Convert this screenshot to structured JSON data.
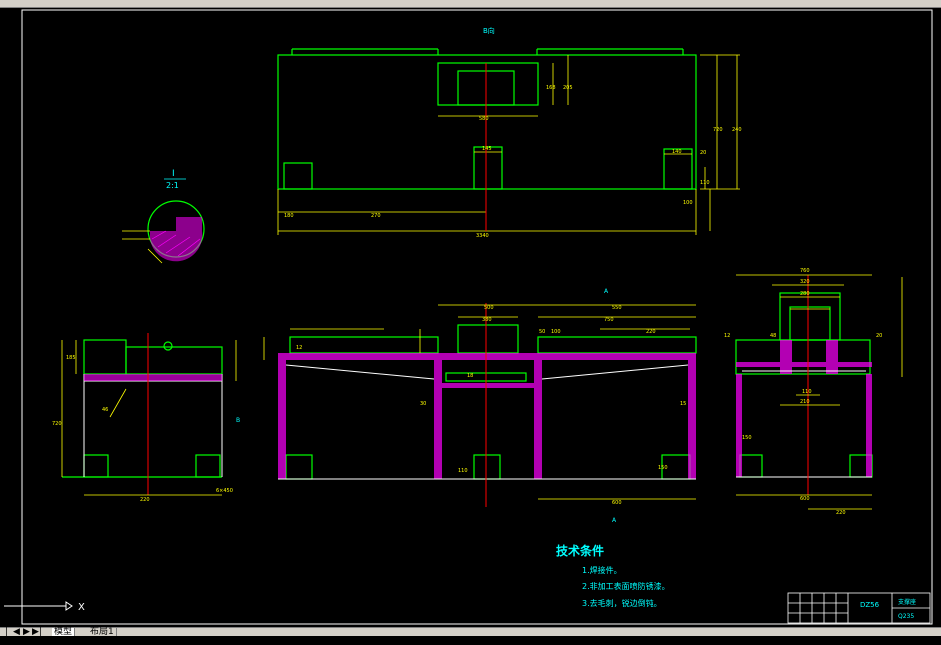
{
  "app": {
    "layout_tabs": [
      "模型",
      "布局1"
    ],
    "nav_buttons": [
      "|◀",
      "◀",
      "▶",
      "▶|"
    ]
  },
  "drawing": {
    "top_view_label": "B向",
    "detail_label_top": "I",
    "detail_label_bottom": "2:1",
    "section_marker": "A",
    "side_marker": "B",
    "weld_note": "6×450",
    "dims_top": {
      "d1": "580",
      "d2": "145",
      "d3": "140",
      "d4": "270",
      "d5": "180",
      "d6": "3340",
      "d7": "100",
      "d8": "20",
      "d9": "168",
      "d10": "205",
      "d11": "720",
      "d12": "110",
      "d13": "240"
    },
    "dims_front": {
      "d1": "500",
      "d2": "550",
      "d3": "380",
      "d4": "750",
      "d5": "220",
      "d6": "100",
      "d7": "50",
      "d8": "12",
      "d9": "18",
      "d10": "150",
      "d11": "600",
      "d12": "30",
      "d13": "110",
      "d14": "15"
    },
    "dims_side": {
      "d1": "760",
      "d2": "320",
      "d3": "280",
      "d4": "210",
      "d5": "110",
      "d6": "150",
      "d7": "600",
      "d8": "220",
      "d9": "48",
      "d10": "12",
      "d11": "20"
    },
    "dims_left": {
      "d1": "185",
      "d2": "720",
      "d3": "220",
      "d4": "46"
    }
  },
  "tech_requirements": {
    "title": "技术条件",
    "items": [
      "1.焊接件。",
      "2.非加工表面喷防锈漆。",
      "3.去毛刺，锐边倒钝。"
    ]
  },
  "title_block": {
    "part_code": "DZ56",
    "part_name": "支撑座",
    "material": "Q235"
  },
  "ucs": {
    "axis_label": "X"
  },
  "colors": {
    "background": "#000000",
    "outline": "#00ff00",
    "dimension": "#ffff00",
    "hatch": "#ff00ff",
    "center": "#ff0000",
    "frame": "#ffffff",
    "text": "#00ffff"
  }
}
